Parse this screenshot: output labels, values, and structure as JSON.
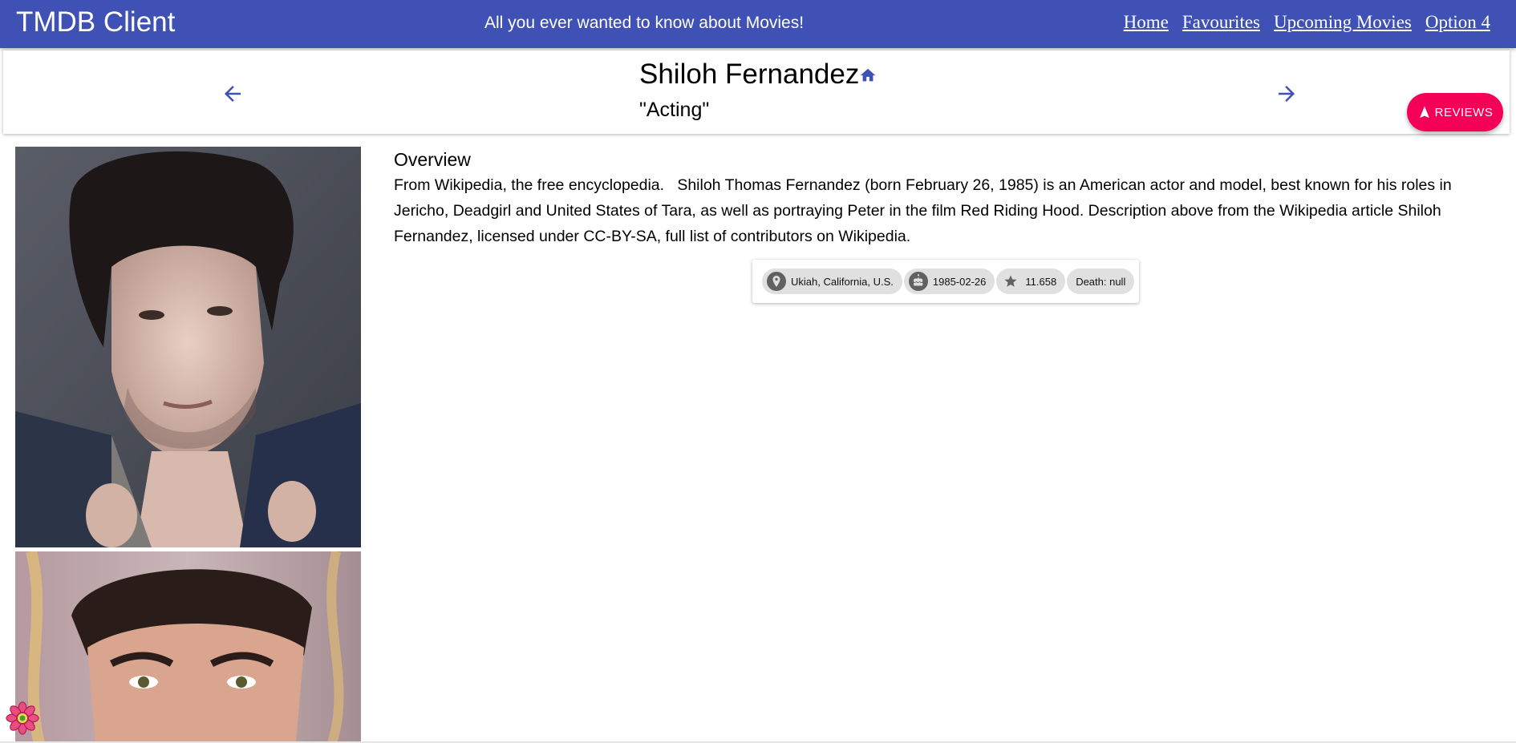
{
  "appbar": {
    "title": "TMDB Client",
    "tagline": "All you ever wanted to know about Movies!",
    "nav": [
      "Home",
      "Favourites",
      "Upcoming Movies",
      "Option 4"
    ]
  },
  "person": {
    "name": "Shiloh Fernandez",
    "role": "\"Acting\""
  },
  "reviews_button": {
    "label": "REVIEWS"
  },
  "overview": {
    "title": "Overview",
    "text": "From Wikipedia, the free encyclopedia.   Shiloh Thomas Fernandez (born February 26, 1985) is an American actor and model, best known for his roles in Jericho, Deadgirl and United States of Tara, as well as portraying Peter in the film Red Riding Hood. Description above from the Wikipedia article Shiloh Fernandez, licensed under CC-BY-SA, full list of contributors on Wikipedia."
  },
  "chips": {
    "birthplace": "Ukiah, California, U.S.",
    "birthday": "1985-02-26",
    "popularity": "11.658",
    "death": "Death: null"
  },
  "icons": {
    "nav_prev": "arrow-back-icon",
    "nav_next": "arrow-forward-icon",
    "home": "home-icon",
    "reviews": "navigation-icon",
    "birthplace": "location-pin-icon",
    "birthday": "cake-icon",
    "popularity": "star-icon",
    "devtools": "react-logo-icon"
  },
  "colors": {
    "primary": "#3f51b5",
    "accent": "#f50057",
    "chip": "#e0e0e0"
  }
}
